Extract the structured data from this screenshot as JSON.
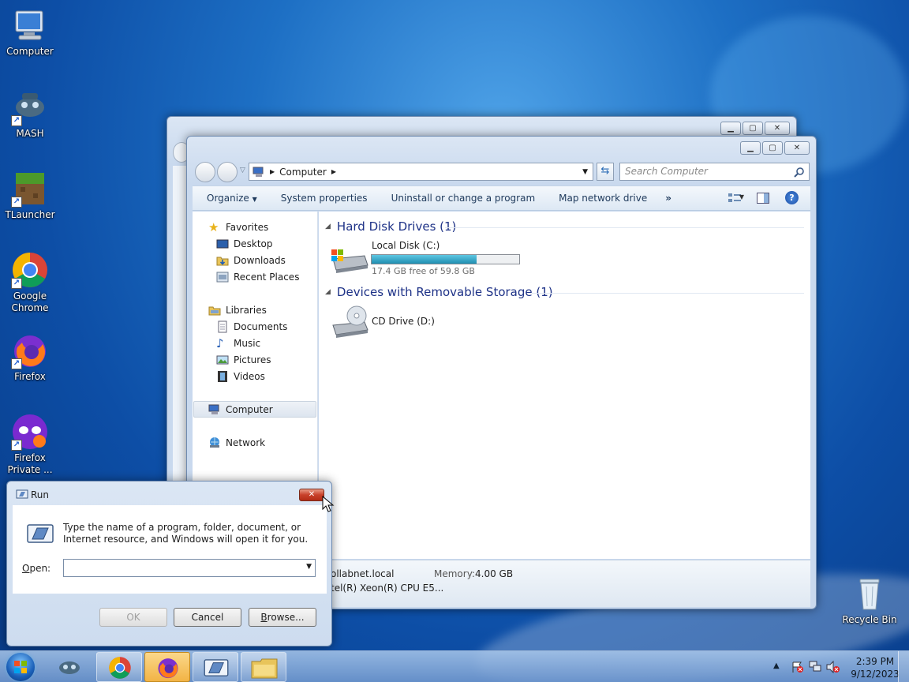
{
  "desktop": {
    "icons": [
      {
        "label": "Computer"
      },
      {
        "label": "MASH"
      },
      {
        "label": "TLauncher"
      },
      {
        "label": "Google Chrome"
      },
      {
        "label": "Firefox"
      },
      {
        "label": "Firefox Private ..."
      },
      {
        "label": "Recycle Bin"
      }
    ]
  },
  "explorer": {
    "breadcrumb": "Computer",
    "search_placeholder": "Search Computer",
    "commands": {
      "organize": "Organize",
      "system_properties": "System properties",
      "uninstall": "Uninstall or change a program",
      "map_drive": "Map network drive",
      "more": "»"
    },
    "nav": {
      "favorites": "Favorites",
      "desktop": "Desktop",
      "downloads": "Downloads",
      "recent": "Recent Places",
      "libraries": "Libraries",
      "documents": "Documents",
      "music": "Music",
      "pictures": "Pictures",
      "videos": "Videos",
      "computer": "Computer",
      "network": "Network"
    },
    "groups": {
      "hdd_header": "Hard Disk Drives (1)",
      "removable_header": "Devices with Removable Storage (1)"
    },
    "local_disk": {
      "name": "Local Disk (C:)",
      "free_text": "17.4 GB free of 59.8 GB",
      "used_fraction": 0.709
    },
    "cd_drive": {
      "name": "CD Drive (D:)"
    },
    "details": {
      "domain_partial": "ollabnet.local",
      "memory_label": "Memory:",
      "memory_value": "4.00 GB",
      "cpu_partial": "tel(R) Xeon(R) CPU E5..."
    }
  },
  "run_dialog": {
    "title": "Run",
    "description": "Type the name of a program, folder, document, or Internet resource, and Windows will open it for you.",
    "open_label": "Open:",
    "open_value": "",
    "ok_label": "OK",
    "cancel_label": "Cancel",
    "browse_label": "Browse..."
  },
  "taskbar": {
    "time": "2:39 PM",
    "date": "9/12/2023"
  },
  "colors": {
    "disk_bar": "#2ba7c8",
    "link_blue": "#1e3287"
  }
}
